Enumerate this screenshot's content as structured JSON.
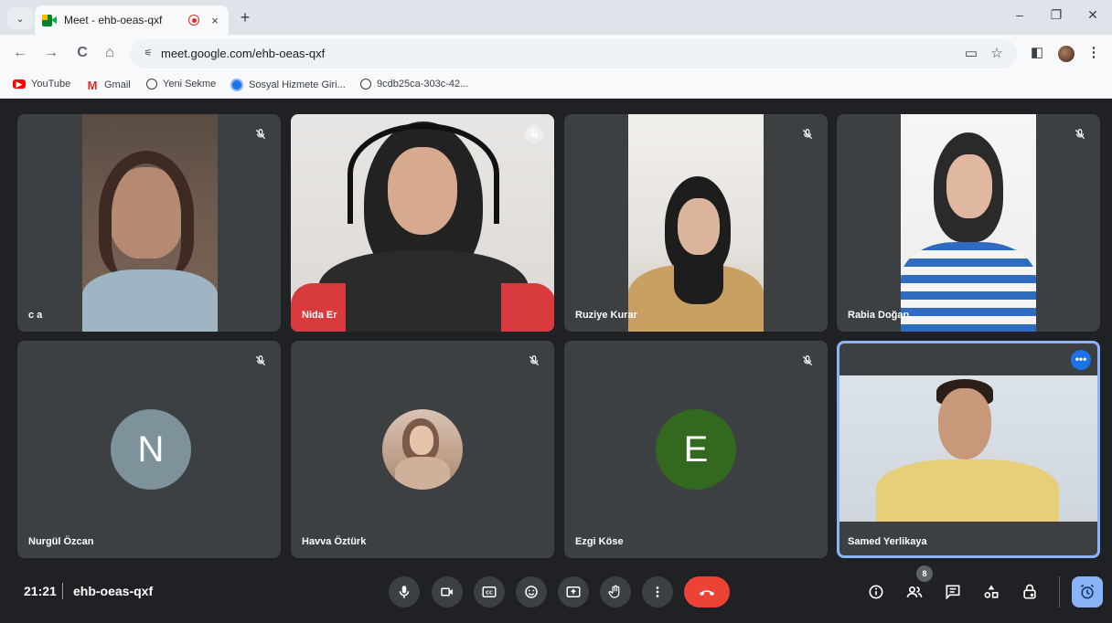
{
  "browser": {
    "tab_title": "Meet - ehb-oeas-qxf",
    "tab_close": "×",
    "new_tab": "+",
    "url": "meet.google.com/ehb-oeas-qxf",
    "window_controls": [
      "–",
      "❐",
      "✕"
    ],
    "bookmarks": [
      {
        "label": "YouTube",
        "icon": "youtube-icon"
      },
      {
        "label": "Gmail",
        "icon": "gmail-icon"
      },
      {
        "label": "Yeni Sekme",
        "icon": "globe-icon"
      },
      {
        "label": "Sosyal Hizmete Giri...",
        "icon": "site-icon"
      },
      {
        "label": "9cdb25ca-303c-42...",
        "icon": "globe-icon"
      }
    ],
    "colors": {
      "tabstrip": "#dfe3ea",
      "toolbar": "#f8f9fb"
    }
  },
  "meeting": {
    "time": "21:21",
    "code": "ehb-oeas-qxf",
    "participant_count": "8",
    "participants": [
      {
        "name": "c a",
        "muted": true,
        "type": "video"
      },
      {
        "name": "Nida Er",
        "muted": true,
        "type": "video"
      },
      {
        "name": "Ruziye Kurar",
        "muted": true,
        "type": "video"
      },
      {
        "name": "Rabia Doğan",
        "muted": true,
        "type": "video"
      },
      {
        "name": "Nurgül Özcan",
        "muted": true,
        "type": "avatar",
        "initial": "N",
        "color": "#7e929b"
      },
      {
        "name": "Havva Öztürk",
        "muted": true,
        "type": "photo-avatar"
      },
      {
        "name": "Ezgi Köse",
        "muted": true,
        "type": "avatar",
        "initial": "E",
        "color": "#33691e"
      },
      {
        "name": "Samed Yerlikaya",
        "muted": false,
        "type": "video",
        "active": true
      }
    ],
    "more_options": "•••",
    "colors": {
      "background": "#202124",
      "tile": "#3c4043",
      "hangup": "#ea4335",
      "accent": "#8ab4f8"
    }
  }
}
